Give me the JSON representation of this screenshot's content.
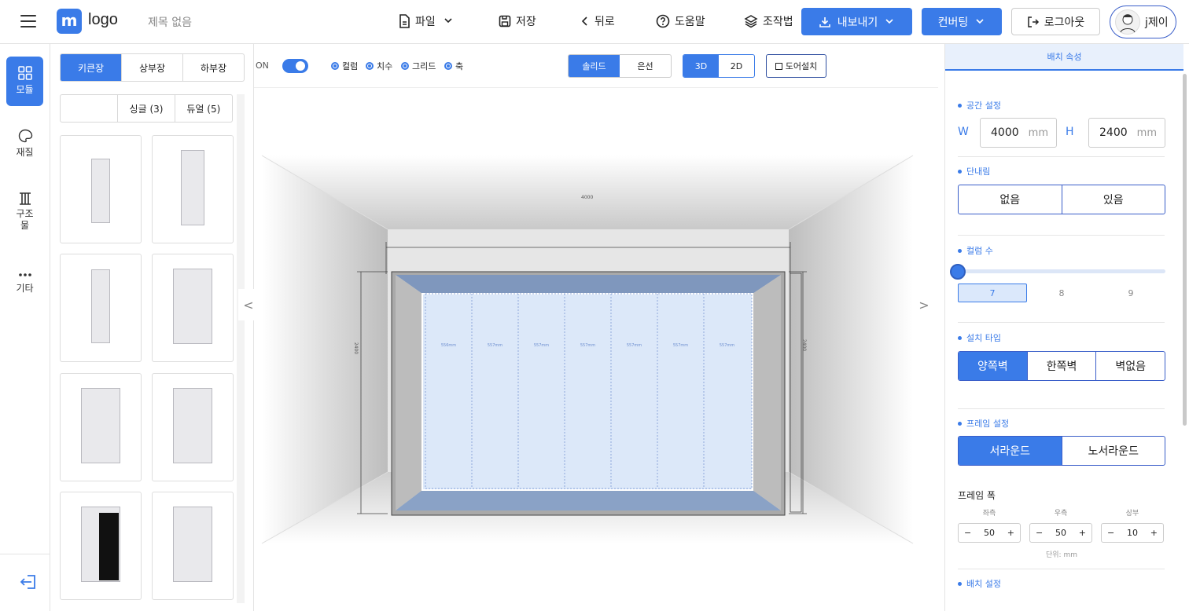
{
  "header": {
    "logo_letter": "m",
    "logo_text": "logo",
    "doc_title": "제목 없음",
    "file_label": "파일",
    "save_label": "저장",
    "back_label": "뒤로",
    "help_label": "도움말",
    "guide_label": "조작법",
    "export_label": "내보내기",
    "convert_label": "컨버팅",
    "logout_label": "로그아웃",
    "user_name": "j제이"
  },
  "leftnav": {
    "items": [
      {
        "label": "모듈",
        "icon": "grid-icon"
      },
      {
        "label": "재질",
        "icon": "palette-icon"
      },
      {
        "label": "구조물",
        "icon": "pillar-icon"
      },
      {
        "label": "기타",
        "icon": "more-icon"
      }
    ]
  },
  "panel": {
    "tabs": [
      "키큰장",
      "상부장",
      "하부장"
    ],
    "subtabs": [
      "",
      "싱글 (3)",
      "듀얼 (5)"
    ]
  },
  "viewer": {
    "on_label": "ON",
    "radios": [
      "컬럼",
      "치수",
      "그리드",
      "축"
    ],
    "render_modes": [
      "솔리드",
      "은선"
    ],
    "view_modes": [
      "3D",
      "2D"
    ],
    "door_label": "도어설치",
    "dim_top": "4000",
    "dim_left": "2400",
    "dim_right": "2400",
    "column_labels": [
      "556mm",
      "557mm",
      "557mm",
      "557mm",
      "557mm",
      "557mm",
      "557mm"
    ],
    "nav_prev": "<",
    "nav_next": ">"
  },
  "right": {
    "tab_label": "배치 속성",
    "space_title": "공간 설정",
    "w_label": "W",
    "w_value": "4000",
    "h_label": "H",
    "h_value": "2400",
    "unit": "mm",
    "step_title": "단내림",
    "step_options": [
      "없음",
      "있음"
    ],
    "columns_title": "컬럼 수",
    "column_options": [
      "7",
      "8",
      "9"
    ],
    "install_title": "설치 타입",
    "install_options": [
      "양쪽벽",
      "한쪽벽",
      "벽없음"
    ],
    "frame_title": "프레임 설정",
    "frame_options": [
      "서라운드",
      "노서라운드"
    ],
    "frame_width_title": "프레임 폭",
    "frame_fields": [
      {
        "label": "좌측",
        "value": "50"
      },
      {
        "label": "우측",
        "value": "50"
      },
      {
        "label": "상부",
        "value": "10"
      }
    ],
    "unit_note": "단위: mm",
    "layout_title": "배치 설정"
  }
}
